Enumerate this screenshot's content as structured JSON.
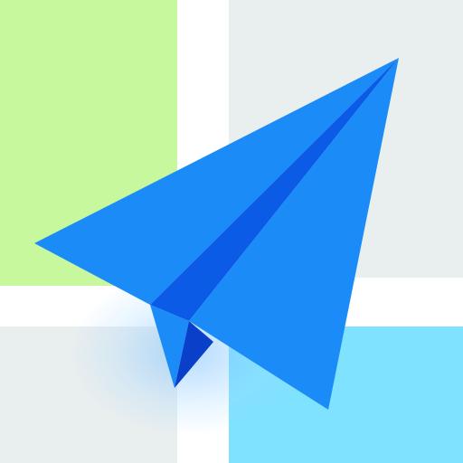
{
  "icon": {
    "name": "paper-plane-map-icon",
    "colors": {
      "map_green": "#C7F89E",
      "map_gray": "#E9EEEF",
      "map_cyan": "#7FE2FF",
      "plane_blue": "#1A8BF7",
      "plane_dark_blue": "#0B5BE6",
      "plane_deep_blue": "#0A3FC9"
    }
  }
}
